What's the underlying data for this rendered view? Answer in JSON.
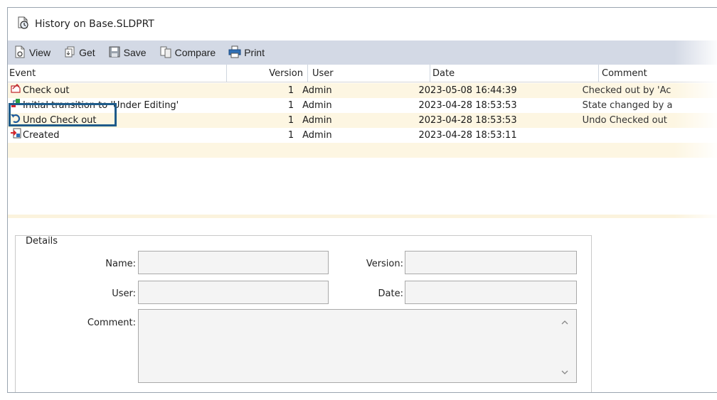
{
  "window": {
    "title": "History on Base.SLDPRT"
  },
  "toolbar": {
    "view_label": "View",
    "get_label": "Get",
    "save_label": "Save",
    "compare_label": "Compare",
    "print_label": "Print"
  },
  "grid": {
    "columns": [
      "Event",
      "Version",
      "User",
      "Date",
      "Comment"
    ],
    "rows": [
      {
        "event": "Check out",
        "icon": "check-out-icon",
        "version": "1",
        "user": "Admin",
        "date": "2023-05-08 16:44:39",
        "comment": "Checked out by 'Ac"
      },
      {
        "event": "Initial transition to 'Under Editing'",
        "icon": "transition-icon",
        "version": "1",
        "user": "Admin",
        "date": "2023-04-28 18:53:53",
        "comment": "State changed by a"
      },
      {
        "event": "Undo Check out",
        "icon": "undo-icon",
        "version": "1",
        "user": "Admin",
        "date": "2023-04-28 18:53:53",
        "comment": "Undo Checked out"
      },
      {
        "event": "Created",
        "icon": "created-icon",
        "version": "1",
        "user": "Admin",
        "date": "2023-04-28 18:53:11",
        "comment": ""
      }
    ]
  },
  "details": {
    "legend": "Details",
    "name_label": "Name:",
    "version_label": "Version:",
    "user_label": "User:",
    "date_label": "Date:",
    "comment_label": "Comment:",
    "name_value": "",
    "version_value": "",
    "user_value": "",
    "date_value": "",
    "comment_value": ""
  },
  "colors": {
    "toolbar_bg": "#d3d9e5",
    "row_alt_bg": "#fdf6e2",
    "highlight_border": "#1e5b8a"
  }
}
